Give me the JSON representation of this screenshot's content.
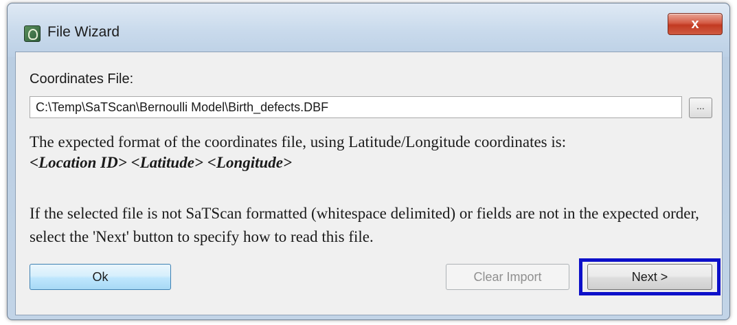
{
  "window": {
    "title": "File Wizard",
    "app_icon": "satscan-app-icon",
    "close_label": "x"
  },
  "coordinates": {
    "label": "Coordinates File:",
    "file_path": "C:\\Temp\\SaTScan\\Bernoulli Model\\Birth_defects.DBF",
    "browse_label": "..."
  },
  "description": {
    "text": "The expected format of the coordinates file, using Latitude/Longitude coordinates is:",
    "format": "<Location ID> <Latitude> <Longitude>",
    "note": "If the selected file is not SaTScan formatted (whitespace delimited) or fields are not in the expected order, select the 'Next' button to specify how to read this file."
  },
  "buttons": {
    "ok": "Ok",
    "clear_import": "Clear Import",
    "next": "Next >"
  },
  "colors": {
    "highlight": "#0d10c9",
    "close": "#c23a22"
  }
}
